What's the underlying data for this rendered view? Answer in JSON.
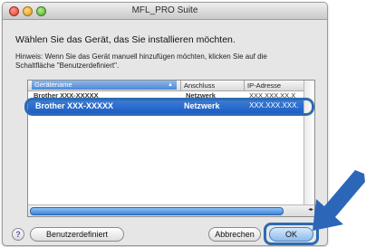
{
  "window": {
    "title": "MFL_PRO Suite"
  },
  "dialog": {
    "heading": "Wählen Sie das Gerät, das Sie installieren möchten.",
    "hint": "Hinweis: Wenn Sie das Gerät manuell hinzufügen möchten, klicken Sie auf die Schaltfläche \"Benutzerdefiniert\"."
  },
  "table": {
    "columns": [
      "Gerätename",
      "Anschluss",
      "IP-Adresse"
    ],
    "rows": [
      {
        "name": "Brother XXX-XXXXX",
        "connection": "Netzwerk",
        "ip": "XXX.XXX.XX.X"
      },
      {
        "name": "Brother XXX-XXXXX",
        "connection": "Netzwerk",
        "ip": "XXX.XXX.XXX."
      }
    ],
    "scroll_arrows": "◂ ▸"
  },
  "buttons": {
    "help": "?",
    "custom": "Benutzerdefiniert",
    "cancel": "Abbrechen",
    "ok": "OK"
  },
  "colors": {
    "selection": "#1f63c9",
    "callout": "#2d6bb0",
    "arrow": "#2c66b8"
  }
}
